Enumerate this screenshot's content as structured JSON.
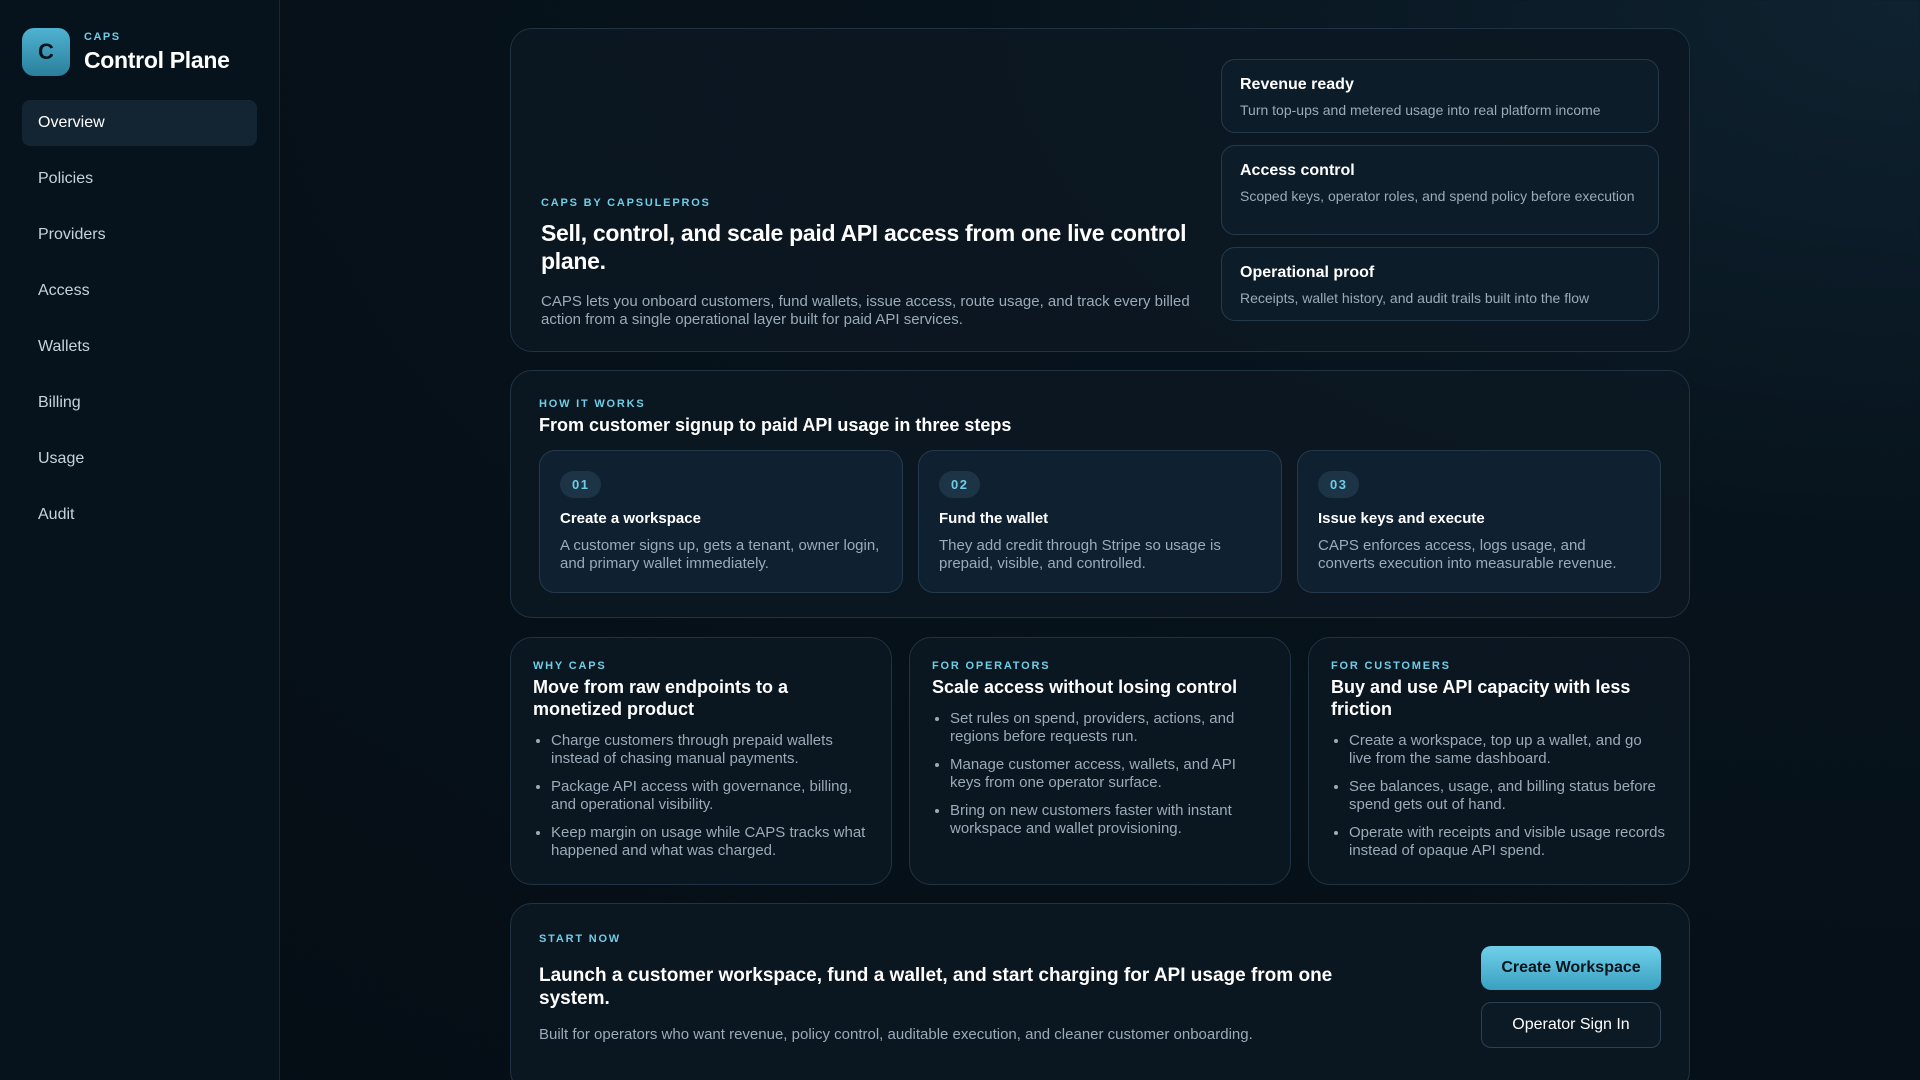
{
  "brand": {
    "logo_letter": "C",
    "kicker": "CAPS",
    "title": "Control Plane"
  },
  "sidebar": {
    "items": [
      {
        "label": "Overview",
        "active": true
      },
      {
        "label": "Policies"
      },
      {
        "label": "Providers"
      },
      {
        "label": "Access"
      },
      {
        "label": "Wallets"
      },
      {
        "label": "Billing"
      },
      {
        "label": "Usage"
      },
      {
        "label": "Audit"
      }
    ]
  },
  "hero": {
    "kicker": "CAPS BY CAPSULEPROS",
    "title": "Sell, control, and scale paid API access from one live control plane.",
    "description": "CAPS lets you onboard customers, fund wallets, issue access, route usage, and track every billed action from a single operational layer built for paid API services.",
    "features": [
      {
        "title": "Revenue ready",
        "description": "Turn top-ups and metered usage into real platform income"
      },
      {
        "title": "Access control",
        "description": "Scoped keys, operator roles, and spend policy before execution"
      },
      {
        "title": "Operational proof",
        "description": "Receipts, wallet history, and audit trails built into the flow"
      }
    ]
  },
  "how": {
    "kicker": "HOW IT WORKS",
    "title": "From customer signup to paid API usage in three steps",
    "steps": [
      {
        "number": "01",
        "title": "Create a workspace",
        "description": "A customer signs up, gets a tenant, owner login, and primary wallet immediately."
      },
      {
        "number": "02",
        "title": "Fund the wallet",
        "description": "They add credit through Stripe so usage is prepaid, visible, and controlled."
      },
      {
        "number": "03",
        "title": "Issue keys and execute",
        "description": "CAPS enforces access, logs usage, and converts execution into measurable revenue."
      }
    ]
  },
  "why_cards": [
    {
      "kicker": "WHY CAPS",
      "title": "Move from raw endpoints to a monetized product",
      "bullets": [
        "Charge customers through prepaid wallets instead of chasing manual payments.",
        "Package API access with governance, billing, and operational visibility.",
        "Keep margin on usage while CAPS tracks what happened and what was charged."
      ]
    },
    {
      "kicker": "FOR OPERATORS",
      "title": "Scale access without losing control",
      "bullets": [
        "Set rules on spend, providers, actions, and regions before requests run.",
        "Manage customer access, wallets, and API keys from one operator surface.",
        "Bring on new customers faster with instant workspace and wallet provisioning."
      ]
    },
    {
      "kicker": "FOR CUSTOMERS",
      "title": "Buy and use API capacity with less friction",
      "bullets": [
        "Create a workspace, top up a wallet, and go live from the same dashboard.",
        "See balances, usage, and billing status before spend gets out of hand.",
        "Operate with receipts and visible usage records instead of opaque API spend."
      ]
    }
  ],
  "start": {
    "kicker": "START NOW",
    "title": "Launch a customer workspace, fund a wallet, and start charging for API usage from one system.",
    "description": "Built for operators who want revenue, policy control, auditable execution, and cleaner customer onboarding.",
    "primary_button": "Create Workspace",
    "secondary_button": "Operator Sign In"
  },
  "colors": {
    "accent": "#6fcde6",
    "background": "#07131c",
    "panel": "#0c1822"
  }
}
